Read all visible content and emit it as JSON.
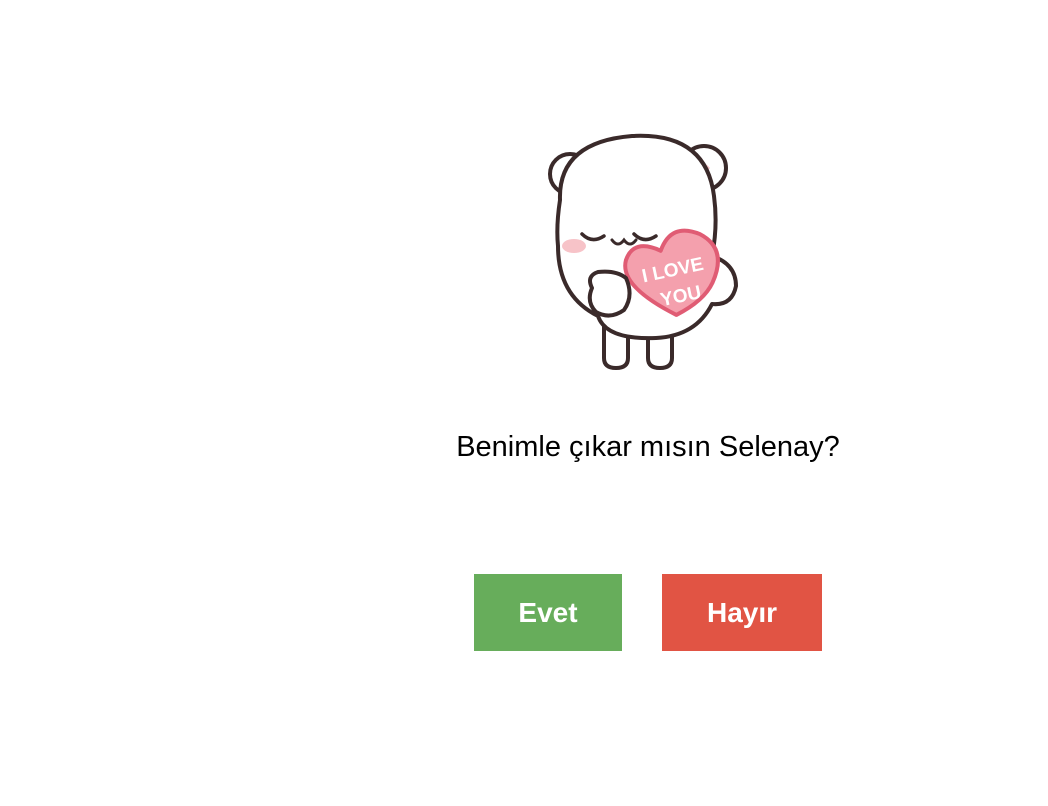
{
  "sticker": {
    "icon": "teddy-bear-holding-heart-icon",
    "heart_line1": "I LOVE",
    "heart_line2": "YOU"
  },
  "question": {
    "text": "Benimle çıkar mısın Selenay?"
  },
  "buttons": {
    "yes_label": "Evet",
    "no_label": "Hayır"
  },
  "colors": {
    "background": "#ffffff",
    "yes": "#67ad5b",
    "no": "#e15444",
    "heart": "#f4a0ad",
    "heart_outline": "#e05c74",
    "bear_outline": "#3a2a2a",
    "blush": "#f7c3c8"
  }
}
